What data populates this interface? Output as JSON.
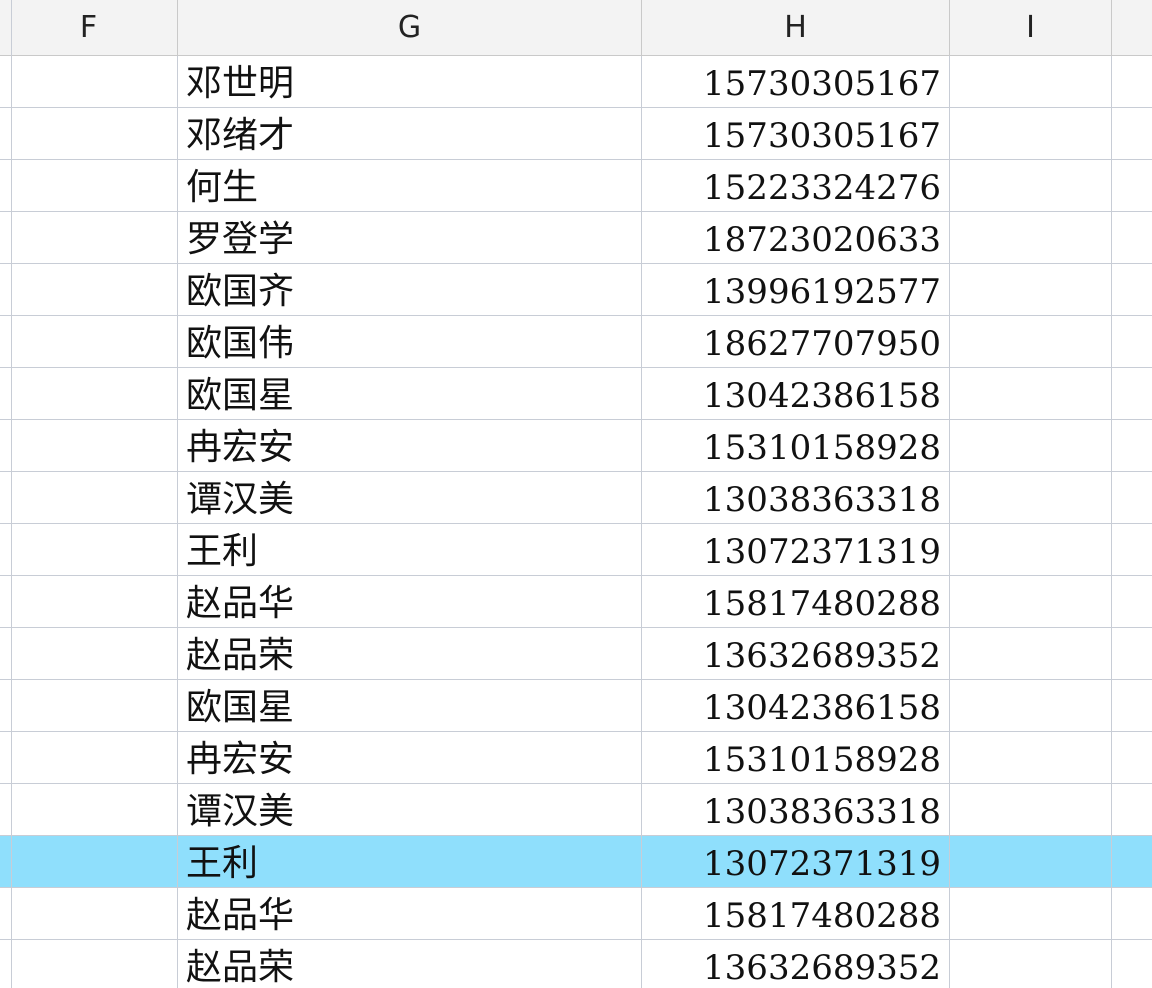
{
  "columns": {
    "f": "F",
    "g": "G",
    "h": "H",
    "i": "I"
  },
  "rows": [
    {
      "name": "邓世明",
      "phone": "15730305167"
    },
    {
      "name": "邓绪才",
      "phone": "15730305167"
    },
    {
      "name": "何生",
      "phone": "15223324276"
    },
    {
      "name": "罗登学",
      "phone": "18723020633"
    },
    {
      "name": "欧国齐",
      "phone": "13996192577"
    },
    {
      "name": "欧国伟",
      "phone": "18627707950"
    },
    {
      "name": "欧国星",
      "phone": "13042386158"
    },
    {
      "name": "冉宏安",
      "phone": "15310158928"
    },
    {
      "name": "谭汉美",
      "phone": "13038363318"
    },
    {
      "name": "王利",
      "phone": "13072371319"
    },
    {
      "name": "赵品华",
      "phone": "15817480288"
    },
    {
      "name": "赵品荣",
      "phone": "13632689352"
    },
    {
      "name": "欧国星",
      "phone": "13042386158"
    },
    {
      "name": "冉宏安",
      "phone": "15310158928"
    },
    {
      "name": "谭汉美",
      "phone": "13038363318"
    },
    {
      "name": "王利",
      "phone": "13072371319"
    },
    {
      "name": "赵品华",
      "phone": "15817480288"
    },
    {
      "name": "赵品荣",
      "phone": "13632689352"
    }
  ],
  "selected_row_index": 15,
  "colors": {
    "selection": "#8fdffc",
    "grid": "#c8cdd6",
    "header_bg": "#f3f3f3"
  }
}
